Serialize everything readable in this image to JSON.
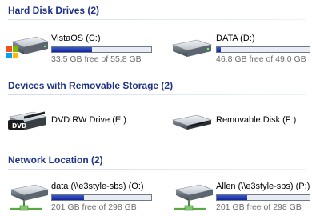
{
  "groups": {
    "hdd": {
      "title": "Hard Disk Drives (2)"
    },
    "removable": {
      "title": "Devices with Removable Storage (2)"
    },
    "network": {
      "title": "Network Location (2)"
    }
  },
  "drives": {
    "c": {
      "name": "VistaOS (C:)",
      "free": "33.5 GB free of 55.8 GB",
      "used_fraction": 0.4
    },
    "d": {
      "name": "DATA (D:)",
      "free": "46.8 GB free of 49.0 GB",
      "used_fraction": 0.045
    },
    "e": {
      "name": "DVD RW Drive (E:)",
      "icon_label": "DVD"
    },
    "f": {
      "name": "Removable Disk (F:)"
    },
    "o": {
      "name": "data (\\\\e3style-sbs) (O:)",
      "free": "201 GB free of 298 GB",
      "used_fraction": 0.325
    },
    "p": {
      "name": "Allen (\\\\e3style-sbs) (P:)",
      "free": "201 GB free of 298 GB",
      "used_fraction": 0.325
    }
  },
  "colors": {
    "group_title": "#1e3287",
    "bar_fill": "#1f35a8",
    "free_text": "#6d6d6d"
  }
}
